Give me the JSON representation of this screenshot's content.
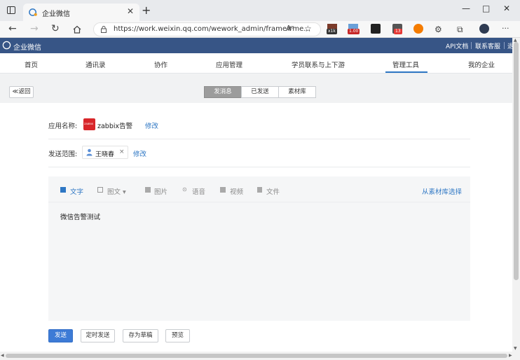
{
  "browser": {
    "tab_title": "企业微信",
    "tab_close": "✕",
    "new_tab": "+",
    "url": "https://work.weixin.qq.com/wework_admin/frame#me...",
    "read_aloud": "Aᵃ",
    "ext_badges": [
      "x1k",
      "1.00",
      "13"
    ],
    "more": "···"
  },
  "header": {
    "brand": "企业微信",
    "links": [
      "API文档",
      "联系客服",
      "退"
    ]
  },
  "mainnav": {
    "items": [
      "首页",
      "通讯录",
      "协作",
      "应用管理",
      "学员联系与上下游",
      "管理工具",
      "我的企业"
    ],
    "active": "管理工具"
  },
  "toolbar": {
    "back": "≪返回",
    "tabs": [
      "发消息",
      "已发送",
      "素材库"
    ],
    "active_tab": "发消息"
  },
  "form": {
    "app_label": "应用名称:",
    "app_icon_text": "ZABBIX",
    "app_name": "zabbix告警",
    "app_edit": "修改",
    "scope_label": "发送范围:",
    "recipient": "王晓春",
    "recipient_remove": "×",
    "scope_edit": "修改"
  },
  "editor": {
    "tools": [
      {
        "label": "文字",
        "icon": "text-icon",
        "active": true
      },
      {
        "label": "图文 ▾",
        "icon": "news-icon",
        "active": false
      },
      {
        "label": "图片",
        "icon": "image-icon",
        "active": false
      },
      {
        "label": "语音",
        "icon": "voice-icon",
        "active": false
      },
      {
        "label": "视频",
        "icon": "video-icon",
        "active": false
      },
      {
        "label": "文件",
        "icon": "file-icon",
        "active": false
      }
    ],
    "library_link": "从素材库选择",
    "content": "微信告警测试"
  },
  "actions": {
    "send": "发送",
    "schedule": "定时发送",
    "draft": "存为草稿",
    "preview": "预览"
  },
  "colors": {
    "header_bg": "#375586",
    "accent": "#2e77c4",
    "primary_button": "#3d7bd6",
    "app_icon": "#d8262a"
  }
}
